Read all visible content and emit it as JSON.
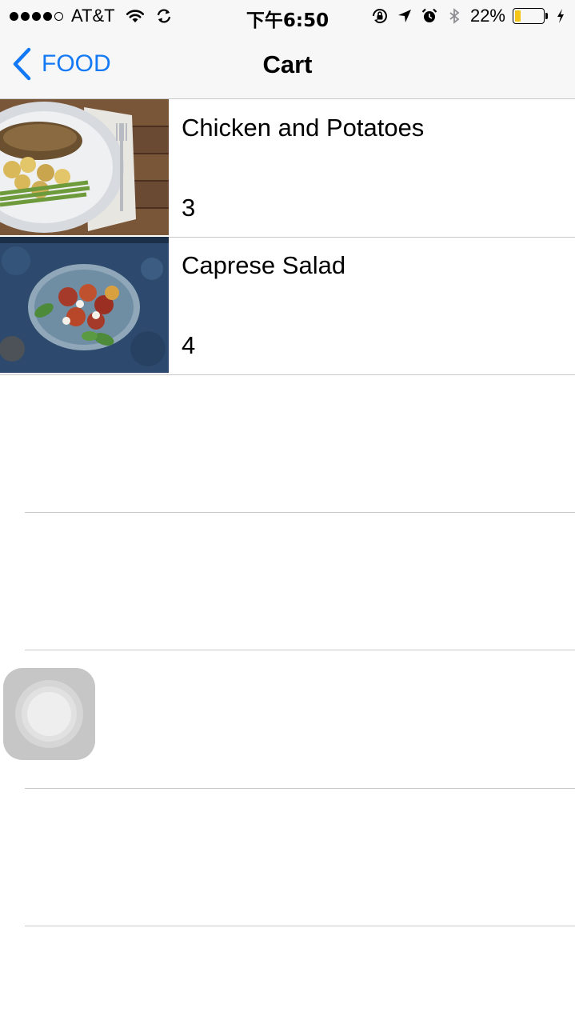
{
  "status_bar": {
    "carrier": "AT&T",
    "time": "下午6:50",
    "battery_percent": "22%",
    "battery_level": 0.22,
    "signal_bars_filled": 4,
    "signal_bars_total": 5,
    "icons": [
      "wifi-icon",
      "sync-icon",
      "orientation-lock-icon",
      "location-arrow-icon",
      "alarm-icon",
      "bluetooth-icon",
      "charging-bolt-icon"
    ]
  },
  "nav": {
    "back_label": "FOOD",
    "title": "Cart",
    "accent_color": "#1479f5"
  },
  "cart_items": [
    {
      "name": "Chicken and Potatoes",
      "quantity": "3",
      "image": "chicken-potatoes-photo"
    },
    {
      "name": "Caprese Salad",
      "quantity": "4",
      "image": "caprese-salad-photo"
    }
  ],
  "empty_rows": 4
}
